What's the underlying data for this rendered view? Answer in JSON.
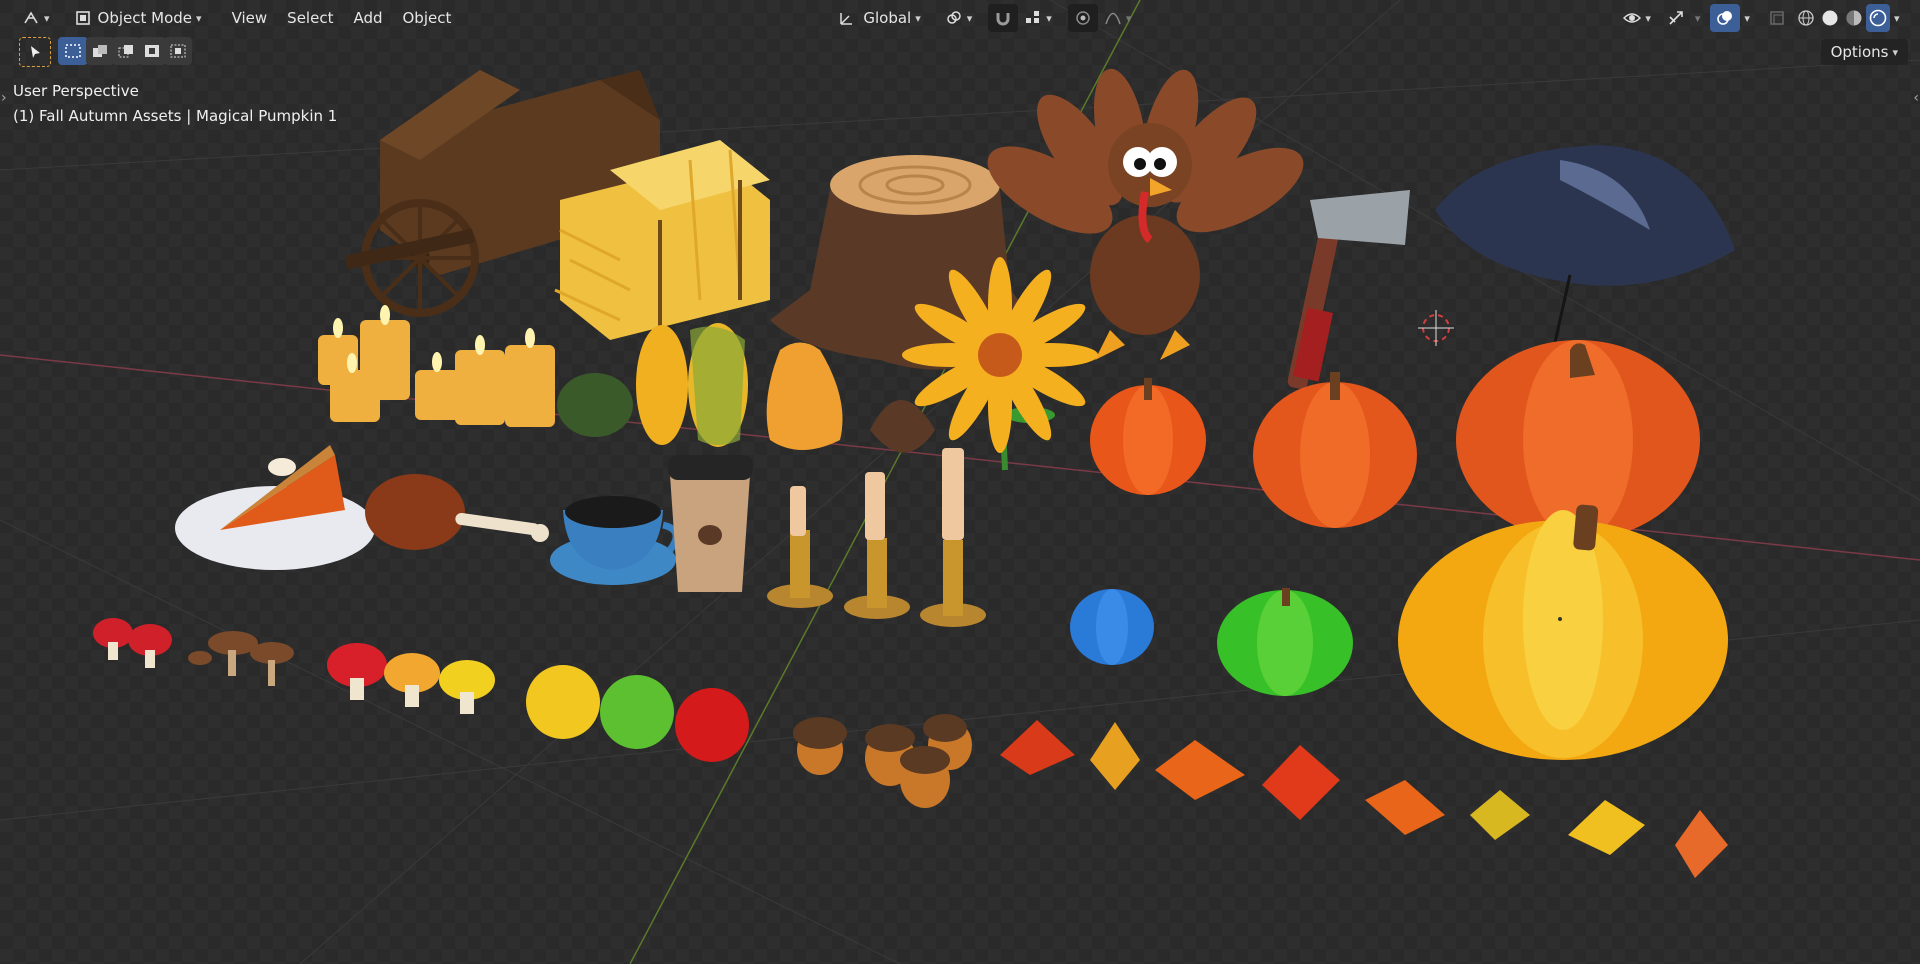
{
  "header": {
    "editor_type_icon": "view3d-icon",
    "mode_icon": "object-mode-icon",
    "mode_label": "Object Mode",
    "menus": [
      "View",
      "Select",
      "Add",
      "Object"
    ],
    "transform_orientation": "Global",
    "transform_icon": "orientation-icon",
    "pivot_icon": "link-pivot-icon",
    "snap_icon": "magnet-icon",
    "snap_target_icon": "snap-grid-icon",
    "proportional_icon": "proportional-edit-icon",
    "falloff_icon": "falloff-curve-icon",
    "visibility_icon": "eye-icon",
    "gizmo_icon": "gizmo-icon",
    "overlay_icon": "overlays-icon",
    "xray_icon": "xray-icon",
    "shading_icons": [
      "wireframe-shading-icon",
      "solid-shading-icon",
      "material-shading-icon",
      "rendered-shading-icon"
    ]
  },
  "toolbar": {
    "select_tool_icon": "cursor-select-icon",
    "select_modes": [
      "select-new-icon",
      "select-extend-icon",
      "select-subtract-icon",
      "select-invert-icon",
      "select-intersect-icon"
    ],
    "options_label": "Options"
  },
  "viewport": {
    "perspective_label": "User Perspective",
    "object_label": "(1) Fall Autumn Assets | Magical Pumpkin 1",
    "accent_blue": "#3d5f98",
    "grid_line": "#3a3a3a",
    "x_axis_color": "#7a3a46",
    "y_axis_color": "#5a7a2a"
  }
}
